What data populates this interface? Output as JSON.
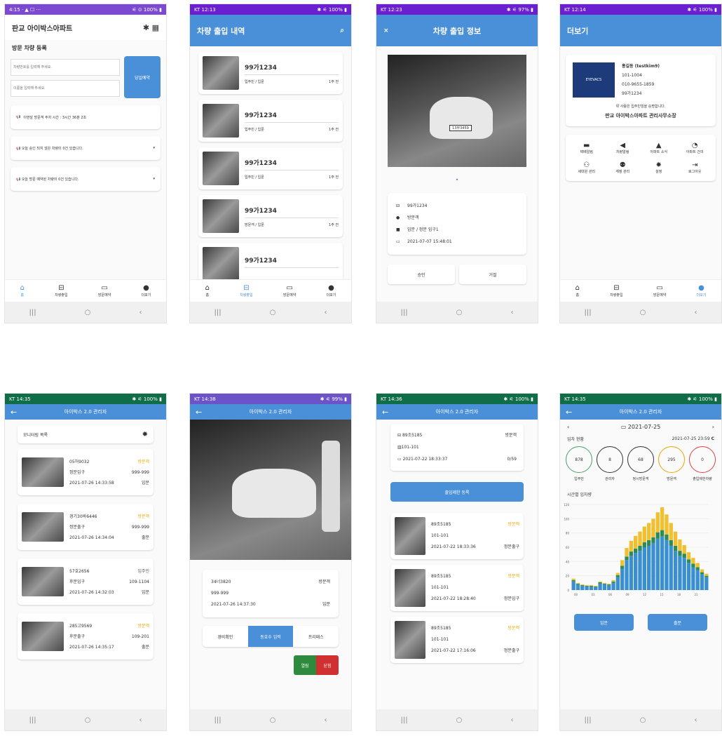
{
  "screens": {
    "s1": {
      "status": "4:15 · ▲ ☐ ···",
      "status_right": "⚟ ⊙ 100% ▮",
      "title": "판교 아이박스아파트",
      "bt_icon": "bluetooth-icon",
      "qr_icon": "qr-icon",
      "section": "방문 차량 등록",
      "car_ph": "차량번호를 입력해 주세요.",
      "name_ph": "이름을 입력해 주세요.",
      "reserve": "당일예약",
      "notices": [
        "이번달 방문객 주차 시간 : 3시간 36분 2초",
        "오늘 승인 되지 않은 차량이 0건 있습니다.",
        "오늘 방문 예약된 차량이 0건 있습니다."
      ]
    },
    "s2": {
      "status": "KT 12:13",
      "status_right": "✱ ⚟ 100% ▮",
      "title": "차량 출입 내역",
      "items": [
        {
          "plate": "99가1234",
          "type": "입주민 / 입문",
          "time": "1주 전"
        },
        {
          "plate": "99가1234",
          "type": "입주민 / 입문",
          "time": "1주 전"
        },
        {
          "plate": "99가1234",
          "type": "입주민 / 입문",
          "time": "1주 전"
        },
        {
          "plate": "99가1234",
          "type": "방문객 / 입문",
          "time": "1주 전"
        },
        {
          "plate": "99가1234",
          "type": "",
          "time": ""
        }
      ]
    },
    "s3": {
      "status": "KT 12:23",
      "status_right": "✱ ⚟ 97% ▮",
      "title": "차량 출입 정보",
      "close": "×",
      "plate_on_car": "13무3459",
      "info": [
        "99가1234",
        "방문객",
        "입문 / 정문 입구1",
        "2021-07-07 15:48:01"
      ],
      "approve": "승인",
      "reject": "거절"
    },
    "s4": {
      "status": "KT 12:14",
      "status_right": "✱ ⚟ 100% ▮",
      "title": "더보기",
      "logo": "EYEVACS",
      "name": "홍길동 (testkim9)",
      "unit": "101-1004",
      "phone": "010-9655-1859",
      "car": "99가1234",
      "cert": "위 사람은 입주민임을 승명합니다.",
      "office": "판교 아이박스아파트 관리사무소장",
      "menus": [
        "택배알림",
        "차량알림",
        "아파트 소식",
        "아파트 건의",
        "세대원 관리",
        "계정 관리",
        "설정",
        "로그아웃"
      ]
    },
    "s5": {
      "status": "KT 14:35",
      "status_right": "✱ ⚟ 100% ▮",
      "title": "아이박스 2.0 관리자",
      "list_title": "모니터링 목록",
      "items": [
        {
          "plate": "05허9032",
          "gate": "정문입구",
          "unit": "999-999",
          "time": "2021-07-26 14:33:58",
          "type": "방문객",
          "dir": "입문",
          "color": "#e6a800"
        },
        {
          "plate": "경기30바6446",
          "gate": "정문출구",
          "unit": "999-999",
          "time": "2021-07-26 14:34:04",
          "type": "방문객",
          "dir": "출문",
          "color": "#e6a800"
        },
        {
          "plate": "57호2656",
          "gate": "후문입구",
          "unit": "109-1104",
          "time": "2021-07-26 14:32:03",
          "type": "입주민",
          "dir": "입문",
          "color": "#555"
        },
        {
          "plate": "285고9569",
          "gate": "후문출구",
          "unit": "109-201",
          "time": "2021-07-26 14:35:17",
          "type": "방문객",
          "dir": "출문",
          "color": "#e6a800"
        }
      ]
    },
    "s6": {
      "status": "KT 14:38",
      "status_right": "✱ ⚟ 99% ▮",
      "title": "아이박스 2.0 관리자",
      "plate": "34너3820",
      "type": "방문객",
      "unit": "999-999",
      "time": "2021-07-26 14:37:30",
      "dir": "입문",
      "btns": [
        "경비확인",
        "동호수 입력",
        "프리패스"
      ],
      "open": "열림",
      "close": "닫힘"
    },
    "s7": {
      "status": "KT 14:36",
      "status_right": "✱ ⚟ 100% ▮",
      "title": "아이박스 2.0 관리자",
      "plate": "89조5185",
      "type": "방문객",
      "unit": "101-101",
      "time": "2021-07-22 18:33:37",
      "count": "0/59",
      "register": "출입제한 등록",
      "items": [
        {
          "plate": "89조5185",
          "unit": "101-101",
          "time": "2021-07-22 18:33:36",
          "gate": "정문출구",
          "type": "방문객"
        },
        {
          "plate": "89조5185",
          "unit": "101-101",
          "time": "2021-07-22 18:28:40",
          "gate": "정문입구",
          "type": "방문객"
        },
        {
          "plate": "89조5185",
          "unit": "101-101",
          "time": "2021-07-22 17:16:06",
          "gate": "정문출구",
          "type": "방문객"
        }
      ]
    },
    "s8": {
      "status": "KT 14:35",
      "status_right": "✱ ⚟ 100% ▮",
      "title": "아이박스 2.0 관리자",
      "date": "2021-07-25",
      "section": "입차 현황",
      "stamp": "2021-07-25 23:59",
      "refresh": "C",
      "circles": [
        {
          "v": "878",
          "l": "입주민",
          "c": "#4aa06a"
        },
        {
          "v": "8",
          "l": "관리자",
          "c": "#333"
        },
        {
          "v": "68",
          "l": "정시방문객",
          "c": "#333"
        },
        {
          "v": "295",
          "l": "방문객",
          "c": "#e6a800"
        },
        {
          "v": "0",
          "l": "출입제한차량",
          "c": "#e04040"
        }
      ],
      "chart_title": "시간별 입차량",
      "in": "입문",
      "out": "출문"
    }
  },
  "chart_data": {
    "type": "bar",
    "title": "시간별 입차량",
    "x_ticks": [
      "00",
      "03",
      "06",
      "09",
      "12",
      "15",
      "18",
      "21"
    ],
    "ylim": [
      0,
      120
    ],
    "y_ticks": [
      "0",
      "20",
      "40",
      "60",
      "80",
      "100",
      "120"
    ],
    "series": [
      {
        "color": "#3a8fd0",
        "values": [
          12,
          8,
          6,
          5,
          5,
          4,
          9,
          8,
          7,
          10,
          18,
          30,
          42,
          48,
          52,
          55,
          60,
          62,
          66,
          72,
          75,
          70,
          62,
          55,
          48,
          45,
          38,
          32,
          28,
          22,
          18
        ]
      },
      {
        "color": "#2e8b57",
        "values": [
          2,
          1,
          1,
          1,
          1,
          1,
          2,
          1,
          1,
          2,
          3,
          4,
          5,
          6,
          6,
          7,
          7,
          8,
          8,
          9,
          9,
          8,
          8,
          7,
          7,
          6,
          5,
          5,
          4,
          3,
          2
        ]
      },
      {
        "color": "#f0c030",
        "values": [
          2,
          1,
          1,
          1,
          1,
          1,
          1,
          1,
          1,
          2,
          3,
          8,
          12,
          15,
          18,
          20,
          22,
          24,
          26,
          28,
          32,
          28,
          24,
          20,
          16,
          12,
          10,
          8,
          6,
          4,
          3
        ]
      }
    ]
  }
}
